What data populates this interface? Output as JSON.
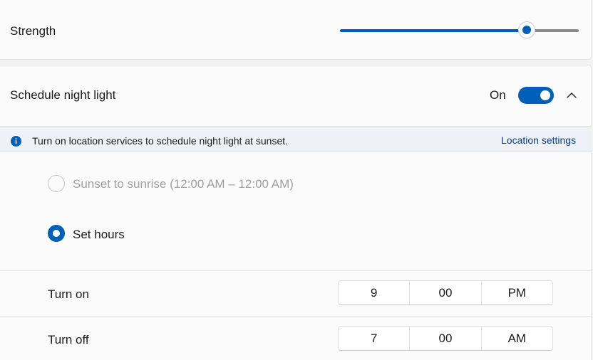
{
  "strength": {
    "label": "Strength",
    "value_fraction": 0.78
  },
  "schedule": {
    "label": "Schedule night light",
    "toggle_state": "On",
    "toggle_on": true
  },
  "info": {
    "message": "Turn on location services to schedule night light at sunset.",
    "link": "Location settings"
  },
  "options": {
    "sunset": "Sunset to sunrise (12:00 AM – 12:00 AM)",
    "set_hours": "Set hours",
    "selected": "set_hours"
  },
  "turn_on": {
    "label": "Turn on",
    "hour": "9",
    "minute": "00",
    "period": "PM"
  },
  "turn_off": {
    "label": "Turn off",
    "hour": "7",
    "minute": "00",
    "period": "AM"
  },
  "colors": {
    "accent": "#005fb8",
    "link": "#003e92"
  },
  "icons": {
    "info": "info-icon",
    "chevron": "chevron-up-icon"
  }
}
